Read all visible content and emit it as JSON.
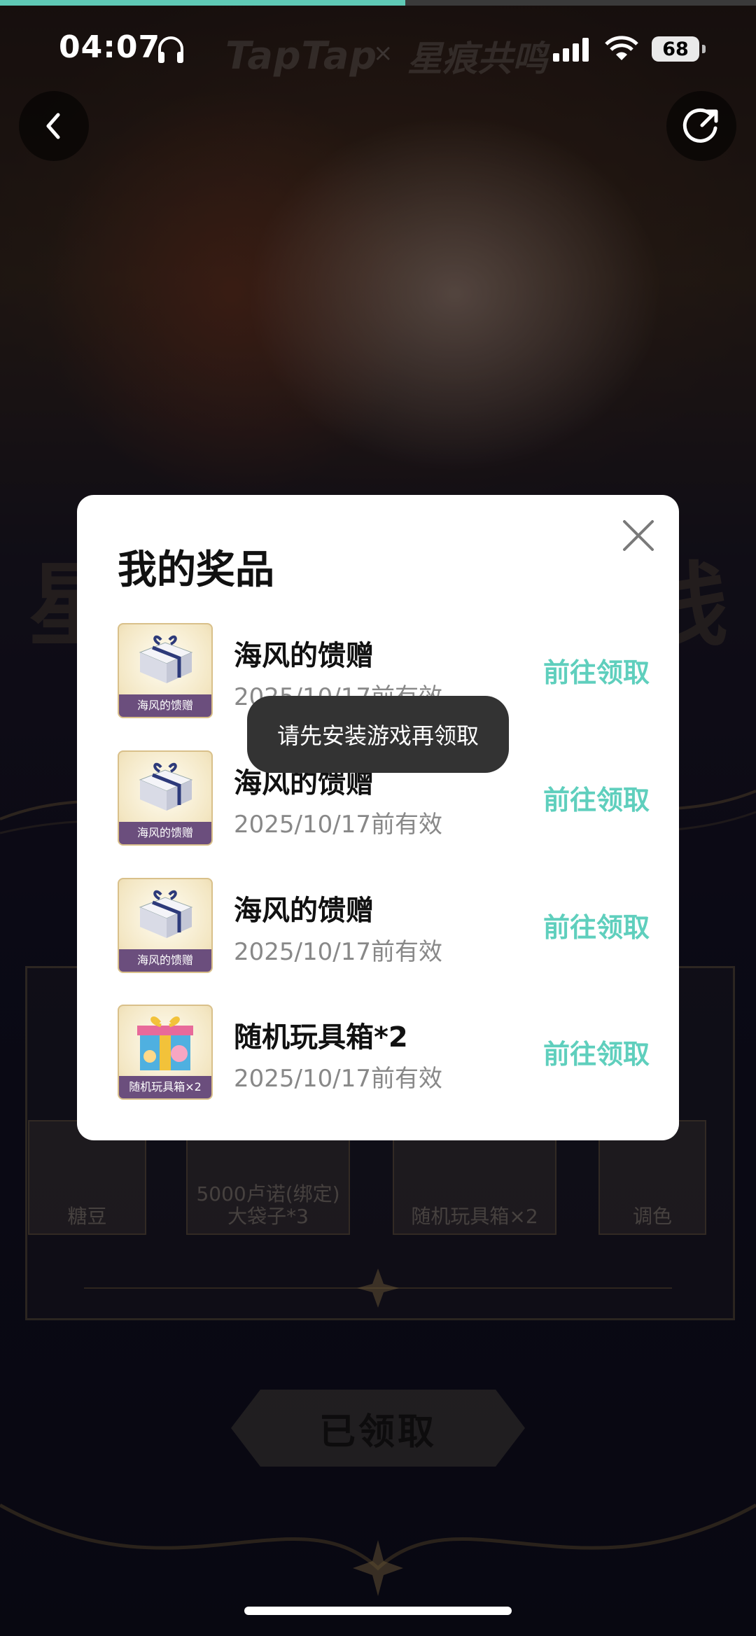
{
  "progress": 0.536,
  "status_bar": {
    "time": "04:07",
    "battery": "68"
  },
  "header": {
    "brand": "TapTap",
    "brand_separator": "×",
    "game_logo": "星痕共鸣"
  },
  "background": {
    "prize_tiles": [
      "糖豆",
      "5000卢诺(绑定)大袋子*3",
      "随机玩具箱×2",
      "调色"
    ],
    "claimed_button": "已领取"
  },
  "modal": {
    "title": "我的奖品",
    "items": [
      {
        "thumb_label": "海风的馈赠",
        "name": "海风的馈赠",
        "expiry": "2025/10/17前有效",
        "action": "前往领取",
        "icon": "gift-box-icon"
      },
      {
        "thumb_label": "海风的馈赠",
        "name": "海风的馈赠",
        "expiry": "2025/10/17前有效",
        "action": "前往领取",
        "icon": "gift-box-icon"
      },
      {
        "thumb_label": "海风的馈赠",
        "name": "海风的馈赠",
        "expiry": "2025/10/17前有效",
        "action": "前往领取",
        "icon": "gift-box-icon"
      },
      {
        "thumb_label": "随机玩具箱×2",
        "name": "随机玩具箱*2",
        "expiry": "2025/10/17前有效",
        "action": "前往领取",
        "icon": "toy-box-icon"
      }
    ]
  },
  "toast": "请先安装游戏再领取",
  "colors": {
    "accent": "#5fcfbd",
    "progress": "#5fc9b5",
    "toast_bg": "#333333"
  }
}
